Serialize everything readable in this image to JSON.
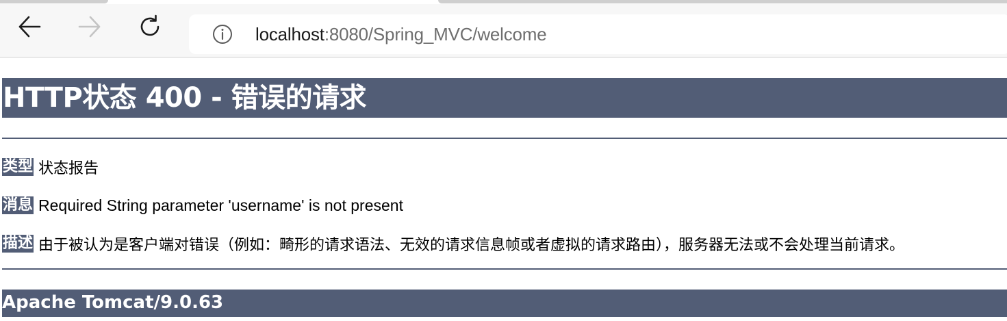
{
  "browser": {
    "address_bar": {
      "url_host": "localhost",
      "url_rest": ":8080/Spring_MVC/welcome"
    },
    "icons": {
      "back": "arrow-left-icon",
      "forward": "arrow-right-icon",
      "reload": "reload-icon",
      "site_info": "info-icon"
    }
  },
  "error_page": {
    "title": "HTTP状态 400 - 错误的请求",
    "type": {
      "label": "类型",
      "value": "状态报告"
    },
    "message": {
      "label": "消息",
      "value": "Required String parameter 'username' is not present"
    },
    "description": {
      "label": "描述",
      "value": "由于被认为是客户端对错误（例如：畸形的请求语法、无效的请求信息帧或者虚拟的请求路由），服务器无法或不会处理当前请求。"
    },
    "footer": "Apache Tomcat/9.0.63"
  },
  "colors": {
    "tomcat_header_bg": "#525d76",
    "tomcat_header_text": "#ffffff",
    "toolbar_bg": "#f7f7f7",
    "url_host": "#1b1b1b",
    "url_rest": "#6e6e6e",
    "disabled_icon": "#c4c4c4"
  }
}
